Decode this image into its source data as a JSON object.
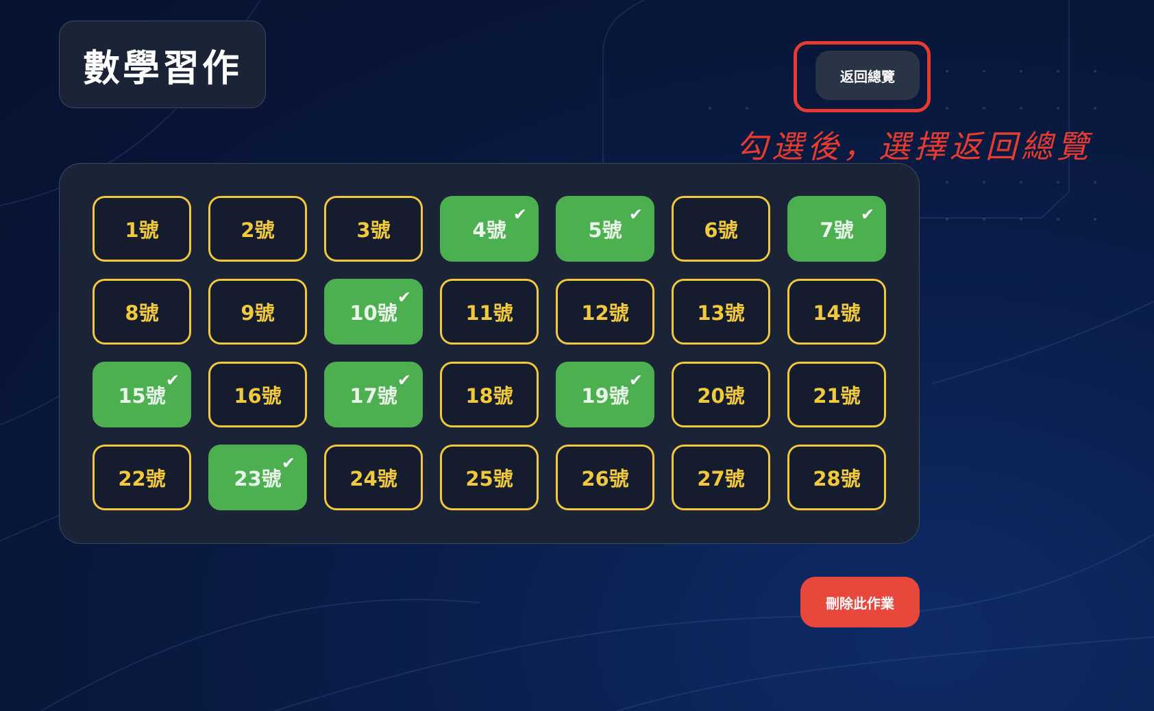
{
  "header": {
    "title": "數學習作",
    "back_label": "返回總覽"
  },
  "annotation": {
    "text": "勾選後，選擇返回總覽",
    "color": "#e83b30"
  },
  "students": [
    {
      "label": "1號",
      "checked": false
    },
    {
      "label": "2號",
      "checked": false
    },
    {
      "label": "3號",
      "checked": false
    },
    {
      "label": "4號",
      "checked": true
    },
    {
      "label": "5號",
      "checked": true
    },
    {
      "label": "6號",
      "checked": false
    },
    {
      "label": "7號",
      "checked": true
    },
    {
      "label": "8號",
      "checked": false
    },
    {
      "label": "9號",
      "checked": false
    },
    {
      "label": "10號",
      "checked": true
    },
    {
      "label": "11號",
      "checked": false
    },
    {
      "label": "12號",
      "checked": false
    },
    {
      "label": "13號",
      "checked": false
    },
    {
      "label": "14號",
      "checked": false
    },
    {
      "label": "15號",
      "checked": true
    },
    {
      "label": "16號",
      "checked": false
    },
    {
      "label": "17號",
      "checked": true
    },
    {
      "label": "18號",
      "checked": false
    },
    {
      "label": "19號",
      "checked": true
    },
    {
      "label": "20號",
      "checked": false
    },
    {
      "label": "21號",
      "checked": false
    },
    {
      "label": "22號",
      "checked": false
    },
    {
      "label": "23號",
      "checked": true
    },
    {
      "label": "24號",
      "checked": false
    },
    {
      "label": "25號",
      "checked": false
    },
    {
      "label": "26號",
      "checked": false
    },
    {
      "label": "27號",
      "checked": false
    },
    {
      "label": "28號",
      "checked": false
    }
  ],
  "icons": {
    "checkmark": "check-icon"
  },
  "footer": {
    "delete_label": "刪除此作業"
  },
  "colors": {
    "unchecked_border": "#f1c93b",
    "checked_fill": "#4caf50",
    "delete": "#e8483b",
    "highlight": "#e83b30"
  }
}
